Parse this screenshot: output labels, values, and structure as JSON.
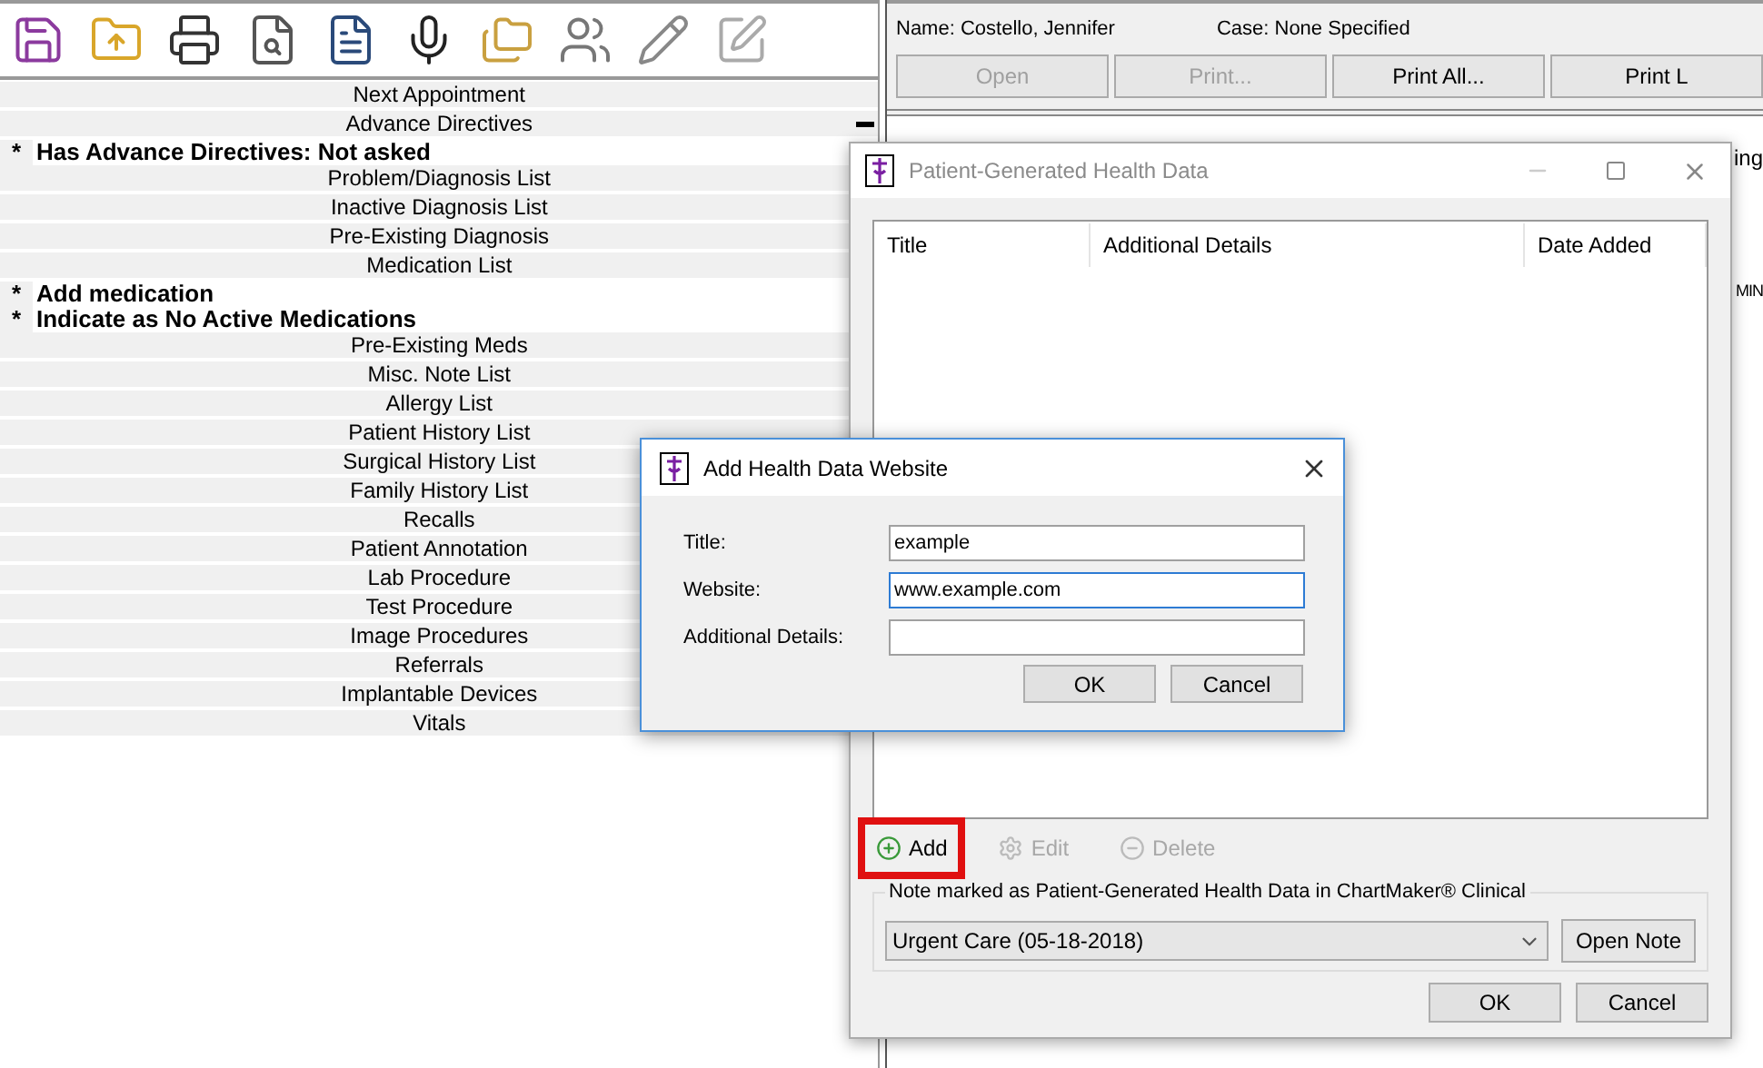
{
  "chart_list": {
    "rows": [
      {
        "kind": "header",
        "text": "Next Appointment"
      },
      {
        "kind": "group",
        "text": "Advance Directives",
        "expanded": true
      },
      {
        "kind": "note",
        "marker": "*",
        "text": "Has Advance Directives: Not asked"
      },
      {
        "kind": "header",
        "text": "Problem/Diagnosis List"
      },
      {
        "kind": "header",
        "text": "Inactive Diagnosis List"
      },
      {
        "kind": "header",
        "text": "Pre-Existing Diagnosis"
      },
      {
        "kind": "header",
        "text": "Medication List"
      },
      {
        "kind": "note",
        "marker": "*",
        "text": "Add medication"
      },
      {
        "kind": "note",
        "marker": "*",
        "text": "Indicate as No Active Medications"
      },
      {
        "kind": "header",
        "text": "Pre-Existing Meds"
      },
      {
        "kind": "header",
        "text": "Misc. Note List"
      },
      {
        "kind": "header",
        "text": "Allergy List"
      },
      {
        "kind": "header",
        "text": "Patient History List"
      },
      {
        "kind": "header",
        "text": "Surgical History List"
      },
      {
        "kind": "header",
        "text": "Family History List"
      },
      {
        "kind": "header",
        "text": "Recalls"
      },
      {
        "kind": "header",
        "text": "Patient Annotation"
      },
      {
        "kind": "header",
        "text": "Lab Procedure"
      },
      {
        "kind": "header",
        "text": "Test Procedure"
      },
      {
        "kind": "header",
        "text": "Image Procedures"
      },
      {
        "kind": "header",
        "text": "Referrals"
      },
      {
        "kind": "header",
        "text": "Implantable Devices"
      },
      {
        "kind": "header",
        "text": "Vitals"
      }
    ]
  },
  "patient": {
    "name": "Name: Costello, Jennifer",
    "case": "Case: None Specified"
  },
  "document_buttons": [
    {
      "label": "Open",
      "disabled": true
    },
    {
      "label": "Print...",
      "disabled": true
    },
    {
      "label": "Print All...",
      "disabled": false
    },
    {
      "label": "Print L",
      "disabled": false
    }
  ],
  "right_fragments": [
    "ing",
    "MIN"
  ],
  "pghd_window": {
    "title": "Patient-Generated Health Data",
    "active": false,
    "columns": [
      "Title",
      "Additional Details",
      "Date Added"
    ],
    "actions": [
      {
        "kind": "add",
        "label": "Add",
        "disabled": false,
        "highlighted": true
      },
      {
        "kind": "edit",
        "label": "Edit",
        "disabled": true,
        "highlighted": false
      },
      {
        "kind": "delete",
        "label": "Delete",
        "disabled": true,
        "highlighted": false
      }
    ],
    "note_group": {
      "legend": "Note marked as Patient-Generated Health Data in ChartMaker® Clinical",
      "selection": "Urgent Care (05-18-2018)",
      "button": "Open Note"
    },
    "buttons": [
      "OK",
      "Cancel"
    ]
  },
  "add_dialog": {
    "title": "Add Health Data Website",
    "fields": [
      {
        "label": "Title:",
        "value": "example",
        "focused": false
      },
      {
        "label": "Website:",
        "value": "www.example.com",
        "focused": true
      },
      {
        "label": "Additional Details:",
        "focused": false
      }
    ],
    "buttons": [
      "OK",
      "Cancel"
    ]
  }
}
